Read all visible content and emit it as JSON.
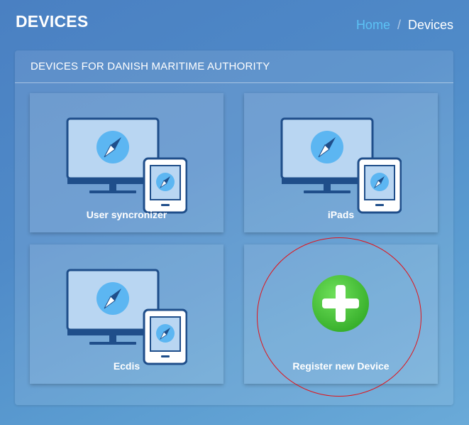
{
  "page": {
    "title": "DEVICES"
  },
  "breadcrumb": {
    "home": "Home",
    "separator": "/",
    "current": "Devices"
  },
  "panel": {
    "title": "DEVICES FOR DANISH MARITIME AUTHORITY"
  },
  "tiles": [
    {
      "label": "User syncronizer",
      "icon": "monitor-tablet-compass-icon"
    },
    {
      "label": "iPads",
      "icon": "monitor-tablet-compass-icon"
    },
    {
      "label": "Ecdis",
      "icon": "monitor-tablet-compass-icon"
    },
    {
      "label": "Register new Device",
      "icon": "plus-circle-icon"
    }
  ],
  "colors": {
    "accent_link": "#5cc2f5",
    "add_green": "#4cc53c",
    "highlight_ring": "#e0141b",
    "icon_stroke": "#1f4e8a"
  }
}
